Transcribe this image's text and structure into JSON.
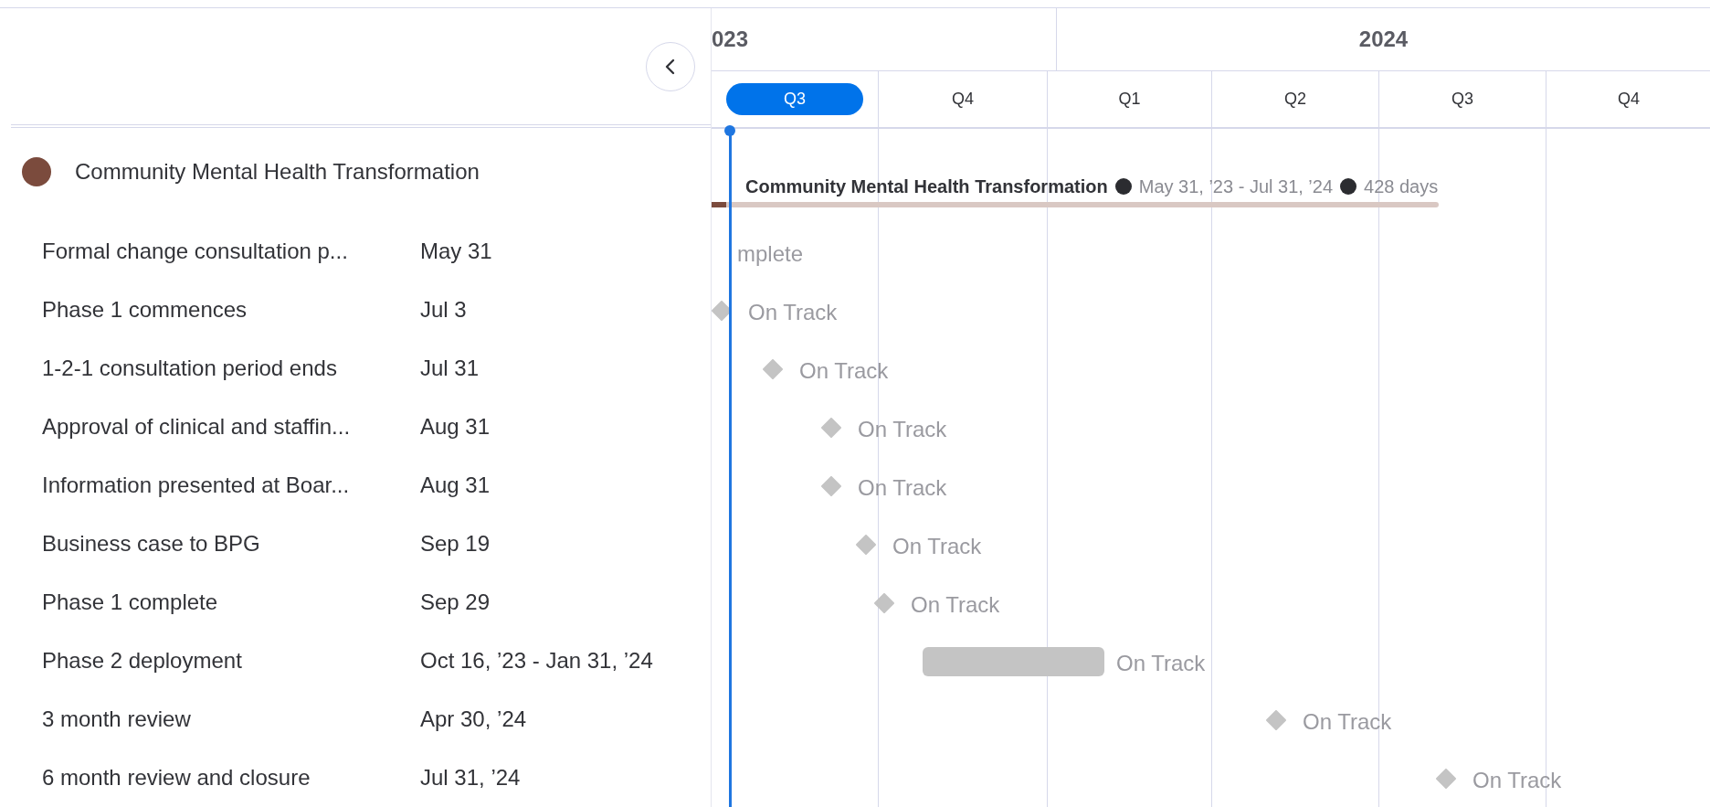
{
  "timeline_header": {
    "years": [
      {
        "label": "023"
      },
      {
        "label": "2024"
      }
    ],
    "quarters": [
      {
        "label": "Q3",
        "selected": true
      },
      {
        "label": "Q4",
        "selected": false
      },
      {
        "label": "Q1",
        "selected": false
      },
      {
        "label": "Q2",
        "selected": false
      },
      {
        "label": "Q3",
        "selected": false
      },
      {
        "label": "Q4",
        "selected": false
      }
    ]
  },
  "group": {
    "name": "Community Mental Health Transformation",
    "color": "#7b4b3d",
    "timeline_title": "Community Mental Health Transformation",
    "date_range": "May 31, ’23 - Jul 31, ’24",
    "duration": "428 days",
    "level": 0.02
  },
  "tasks": [
    {
      "name": "Formal change consultation p...",
      "date": "May 31",
      "kind": "milestone",
      "status": "mplete"
    },
    {
      "name": "Phase 1 commences",
      "date": "Jul 3",
      "kind": "milestone",
      "status": "On Track"
    },
    {
      "name": "1-2-1 consultation period ends",
      "date": "Jul 31",
      "kind": "milestone",
      "status": "On Track"
    },
    {
      "name": "Approval of clinical and staffin...",
      "date": "Aug 31",
      "kind": "milestone",
      "status": "On Track"
    },
    {
      "name": "Information presented at Boar...",
      "date": "Aug 31",
      "kind": "milestone",
      "status": "On Track"
    },
    {
      "name": "Business case to BPG",
      "date": "Sep 19",
      "kind": "milestone",
      "status": "On Track"
    },
    {
      "name": "Phase 1 complete",
      "date": "Sep 29",
      "kind": "milestone",
      "status": "On Track"
    },
    {
      "name": "Phase 2 deployment",
      "date": "Oct 16, ’23 - Jan 31, ’24",
      "kind": "range",
      "status": "On Track"
    },
    {
      "name": "3 month review",
      "date": "Apr 30, ’24",
      "kind": "milestone",
      "status": "On Track"
    },
    {
      "name": "6 month review and closure",
      "date": "Jul 31, ’24",
      "kind": "milestone",
      "status": "On Track"
    }
  ]
}
